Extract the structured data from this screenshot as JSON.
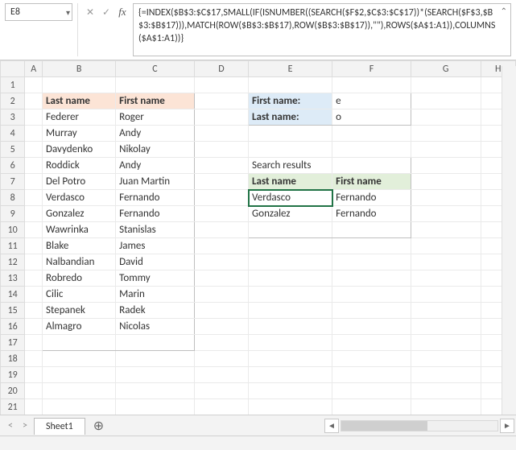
{
  "name_box": "E8",
  "formula": "{=INDEX($B$3:$C$17,SMALL(IF(ISNUMBER((SEARCH($F$2,$C$3:$C$17))*(SEARCH($F$3,$B$3:$B$17))),MATCH(ROW($B$3:$B$17),ROW($B$3:$B$17)),\"\"),ROWS($A$1:A1)),COLUMNS($A$1:A1))}",
  "columns": [
    "A",
    "B",
    "C",
    "D",
    "E",
    "F",
    "G",
    "H"
  ],
  "table1": {
    "headers": {
      "last": "Last name",
      "first": "First name"
    },
    "rows": [
      {
        "last": "Federer",
        "first": "Roger"
      },
      {
        "last": "Murray",
        "first": "Andy"
      },
      {
        "last": "Davydenko",
        "first": "Nikolay"
      },
      {
        "last": "Roddick",
        "first": "Andy"
      },
      {
        "last": "Del Potro",
        "first": "Juan Martin"
      },
      {
        "last": "Verdasco",
        "first": "Fernando"
      },
      {
        "last": "Gonzalez",
        "first": "Fernando"
      },
      {
        "last": "Wawrinka",
        "first": "Stanislas"
      },
      {
        "last": "Blake",
        "first": "James"
      },
      {
        "last": "Nalbandian",
        "first": "David"
      },
      {
        "last": "Robredo",
        "first": "Tommy"
      },
      {
        "last": "Cilic",
        "first": "Marin"
      },
      {
        "last": "Stepanek",
        "first": "Radek"
      },
      {
        "last": "Almagro",
        "first": "Nicolas"
      }
    ]
  },
  "search": {
    "first_label": "First name:",
    "last_label": "Last name:",
    "first_value": "e",
    "last_value": "o",
    "results_title": "Search results",
    "headers": {
      "last": "Last name",
      "first": "First name"
    },
    "results": [
      {
        "last": "Verdasco",
        "first": "Fernando"
      },
      {
        "last": "Gonzalez",
        "first": "Fernando"
      }
    ]
  },
  "sheet_tab": "Sheet1"
}
